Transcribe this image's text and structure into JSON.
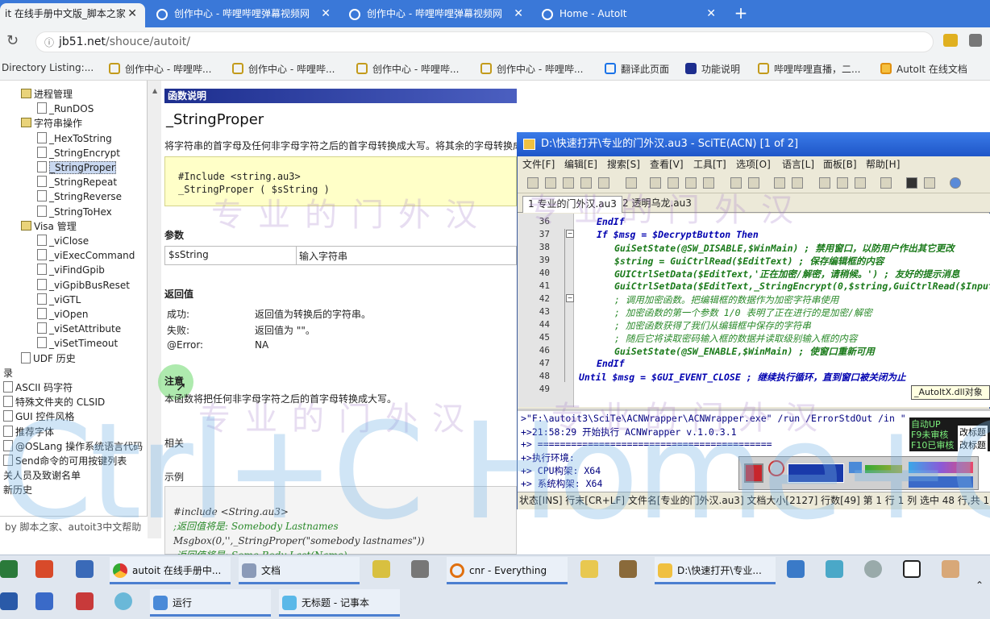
{
  "browser": {
    "tabs": [
      {
        "label": "it 在线手册中文版_脚本之家",
        "active": true
      },
      {
        "label": "创作中心 - 哔哩哔哩弹幕视频网",
        "active": false
      },
      {
        "label": "创作中心 - 哔哩哔哩弹幕视频网",
        "active": false
      },
      {
        "label": "Home - AutoIt",
        "active": false
      }
    ],
    "close_glyph": "✕",
    "new_tab_glyph": "+",
    "url_domain": "jb51.net",
    "url_path": "/shouce/autoit/",
    "bookmarks": [
      "Directory Listing:...",
      "创作中心 - 哔哩哔...",
      "创作中心 - 哔哩哔...",
      "创作中心 - 哔哩哔...",
      "创作中心 - 哔哩哔...",
      "翻译此页面",
      "功能说明",
      "哔哩哔哩直播，二...",
      "AutoIt 在线文档"
    ]
  },
  "tree": {
    "nodes": [
      {
        "label": "进程管理",
        "type": "book",
        "indent": 1
      },
      {
        "label": "_RunDOS",
        "type": "page",
        "indent": 2
      },
      {
        "label": "字符串操作",
        "type": "book",
        "indent": 1
      },
      {
        "label": "_HexToString",
        "type": "page",
        "indent": 2
      },
      {
        "label": "_StringEncrypt",
        "type": "page",
        "indent": 2
      },
      {
        "label": "_StringProper",
        "type": "page",
        "indent": 2,
        "selected": true
      },
      {
        "label": "_StringRepeat",
        "type": "page",
        "indent": 2
      },
      {
        "label": "_StringReverse",
        "type": "page",
        "indent": 2
      },
      {
        "label": "_StringToHex",
        "type": "page",
        "indent": 2
      },
      {
        "label": "Visa 管理",
        "type": "book",
        "indent": 1
      },
      {
        "label": "_viClose",
        "type": "page",
        "indent": 2
      },
      {
        "label": "_viExecCommand",
        "type": "page",
        "indent": 2
      },
      {
        "label": "_viFindGpib",
        "type": "page",
        "indent": 2
      },
      {
        "label": "_viGpibBusReset",
        "type": "page",
        "indent": 2
      },
      {
        "label": "_viGTL",
        "type": "page",
        "indent": 2
      },
      {
        "label": "_viOpen",
        "type": "page",
        "indent": 2
      },
      {
        "label": "_viSetAttribute",
        "type": "page",
        "indent": 2
      },
      {
        "label": "_viSetTimeout",
        "type": "page",
        "indent": 2
      },
      {
        "label": "UDF 历史",
        "type": "page",
        "indent": 1
      },
      {
        "label": "录",
        "type": "none",
        "indent": 0
      },
      {
        "label": "ASCII 码字符",
        "type": "page",
        "indent": 0
      },
      {
        "label": "特殊文件夹的 CLSID",
        "type": "page",
        "indent": 0
      },
      {
        "label": "GUI 控件风格",
        "type": "page",
        "indent": 0
      },
      {
        "label": "推荐字体",
        "type": "page",
        "indent": 0
      },
      {
        "label": "@OSLang 操作系统语言代码",
        "type": "page",
        "indent": 0
      },
      {
        "label": "Send命令的可用按键列表",
        "type": "page",
        "indent": 0
      },
      {
        "label": "关人员及致谢名单",
        "type": "none",
        "indent": 0
      },
      {
        "label": "新历史",
        "type": "none",
        "indent": 0
      }
    ],
    "footer": "by 脚本之家、autoit3中文帮助"
  },
  "doc": {
    "section_bar": "函数说明",
    "title": "_StringProper",
    "description": "将字符串的首字母及任何非字母字符之后的首字母转换成大写。将其余的字母转换成",
    "syntax_line1": "#Include <string.au3>",
    "syntax_line2": "_StringProper ( $sString )",
    "params_heading": "参数",
    "param_name": "$sString",
    "param_desc": "输入字符串",
    "return_heading": "返回值",
    "returns": [
      {
        "k": "成功:",
        "v": "返回值为转换后的字符串。"
      },
      {
        "k": "失败:",
        "v": "返回值为 \"\"。"
      },
      {
        "k": "@Error:",
        "v": "NA"
      }
    ],
    "remark_heading": "注意",
    "remark_text": "本函数将把任何非字母字符之后的首字母转换成大写。",
    "related_heading": "相关",
    "example_heading": "示例",
    "example_lines": [
      "#include <String.au3>",
      ";返回值将是: Somebody Lastnames",
      "Msgbox(0,'',_StringProper(\"somebody lastnames\"))",
      ";返回值将是: Some.Body Last(Name)"
    ]
  },
  "scite": {
    "title": "D:\\快速打开\\专业的门外汉.au3 - SciTE(ACN) [1 of 2]",
    "menu": [
      "文件[F]",
      "编辑[E]",
      "搜索[S]",
      "查看[V]",
      "工具[T]",
      "选项[O]",
      "语言[L]",
      "面板[B]",
      "帮助[H]"
    ],
    "tabs": [
      "1 专业的门外汉.au3",
      "2 透明乌龙.au3"
    ],
    "lines": [
      {
        "n": "36",
        "code": "EndIf"
      },
      {
        "n": "37",
        "code": "If $msg = $DecryptButton Then"
      },
      {
        "n": "38",
        "code": "GuiSetState(@SW_DISABLE,$WinMain) ; 禁用窗口，以防用户作出其它更改"
      },
      {
        "n": "39",
        "code": "$string = GuiCtrlRead($EditText) ; 保存编辑框的内容"
      },
      {
        "n": "40",
        "code": "GUICtrlSetData($EditText,'正在加密/解密，请稍候。') ; 友好的提示消息"
      },
      {
        "n": "41",
        "code": "GuiCtrlSetData($EditText,_StringEncrypt(0,$string,GuiCtrlRead($InputPass)"
      },
      {
        "n": "42",
        "code": "; 调用加密函数。把编辑框的数据作为加密字符串使用"
      },
      {
        "n": "43",
        "code": "; 加密函数的第一个参数 1/0 表明了正在进行的是加密/解密"
      },
      {
        "n": "44",
        "code": "; 加密函数获得了我们从编辑框中保存的字符串"
      },
      {
        "n": "45",
        "code": "; 随后它将读取密码输入框的数据并读取级别输入框的内容"
      },
      {
        "n": "46",
        "code": "GuiSetState(@SW_ENABLE,$WinMain) ; 使窗口重新可用"
      },
      {
        "n": "47",
        "code": "EndIf"
      },
      {
        "n": "48",
        "code": "Until $msg = $GUI_EVENT_CLOSE ; 继续执行循环，直到窗口被关闭为止"
      },
      {
        "n": "49",
        "code": ""
      }
    ],
    "output": [
      ">\"F:\\autoit3\\SciTe\\ACNWrapper\\ACNWrapper.exe\" /run /ErrorStdOut /in \"",
      "+>21:58:29 开始执行 ACNWrapper v.1.0.3.1",
      "+> ==========================================",
      "+>执行环境:",
      "+>      CPU构架:      X64",
      "+>      系统构架:     X64"
    ],
    "status": "状态[INS] 行末[CR+LF] 文件名[专业的门外汉.au3] 文档大小[2127] 行数[49] 第 1 行 1 列 选中 48 行,共 1706 字符",
    "tooltip": "_AutoItX.dll对象",
    "badge_lines": [
      "自动UP",
      "F9未审核",
      "F10已审核"
    ],
    "badge_right": [
      "改标题",
      "改标题"
    ]
  },
  "overlay_text": "Ctrl+C Home+Ctrl+A",
  "watermark": "专业的门外汉",
  "taskbar": {
    "row1": [
      "autoit 在线手册中...",
      "文档",
      "cnr - Everything",
      "D:\\快速打开\\专业..."
    ],
    "row2": [
      "运行",
      "无标题 - 记事本"
    ]
  }
}
